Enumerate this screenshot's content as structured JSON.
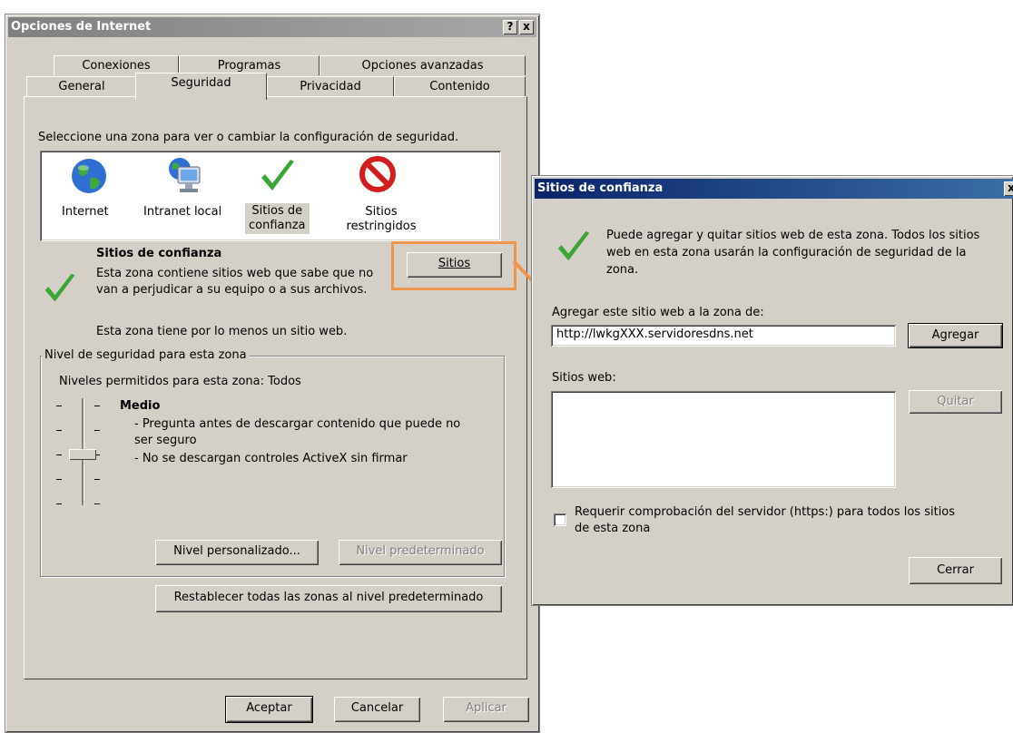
{
  "main_dialog": {
    "title": "Opciones de Internet",
    "help_glyph": "?",
    "close_glyph": "x",
    "tabs_row1": [
      "Conexiones",
      "Programas",
      "Opciones avanzadas"
    ],
    "tabs_row2": [
      "General",
      "Seguridad",
      "Privacidad",
      "Contenido"
    ],
    "zone_prompt": "Seleccione una zona para ver o cambiar la configuración de seguridad.",
    "zones": [
      {
        "label_l1": "Internet",
        "label_l2": "",
        "icon": "globe-icon"
      },
      {
        "label_l1": "Intranet local",
        "label_l2": "",
        "icon": "computer-network-icon"
      },
      {
        "label_l1": "Sitios de",
        "label_l2": "confianza",
        "icon": "green-check-icon"
      },
      {
        "label_l1": "Sitios",
        "label_l2": "restringidos",
        "icon": "red-prohibited-icon"
      }
    ],
    "zone_title": "Sitios de confianza",
    "zone_desc_l1": "Esta zona contiene sitios web que sabe que no",
    "zone_desc_l2": "van a perjudicar a su equipo o a sus archivos.",
    "zone_count_note": "Esta zona tiene por lo menos un sitio web.",
    "sites_button": "Sitios",
    "level_group_title": "Nivel de seguridad para esta zona",
    "allowed_levels": "Niveles permitidos para esta zona: Todos",
    "level_name": "Medio",
    "level_desc_l1": "- Pregunta antes de descargar contenido que puede no",
    "level_desc_l2": "ser seguro",
    "level_desc_l3": "- No se descargan controles ActiveX sin firmar",
    "custom_level_button": "Nivel personalizado...",
    "default_level_button": "Nivel predeterminado",
    "reset_all_button": "Restablecer todas las zonas al nivel predeterminado",
    "ok_button": "Aceptar",
    "cancel_button": "Cancelar",
    "apply_button": "Aplicar"
  },
  "trusted_dialog": {
    "title": "Sitios de confianza",
    "close_glyph": "x",
    "info_l1": "Puede agregar y quitar sitios web de esta zona. Todos los sitios",
    "info_l2": "web en esta zona usarán la configuración de seguridad de la",
    "info_l3": "zona.",
    "add_label": "Agregar este sitio web a la zona de:",
    "url_value": "http://lwkgXXX.servidoresdns.net",
    "add_button": "Agregar",
    "websites_label": "Sitios web:",
    "remove_button": "Quitar",
    "https_label_l1": "Requerir comprobación del servidor (https:) para todos los sitios",
    "https_label_l2": "de esta zona",
    "https_checked": false,
    "close_button": "Cerrar"
  },
  "colors": {
    "highlight": "#f0954c",
    "check_green": "#3aa735",
    "title_active": "#0a246a"
  }
}
